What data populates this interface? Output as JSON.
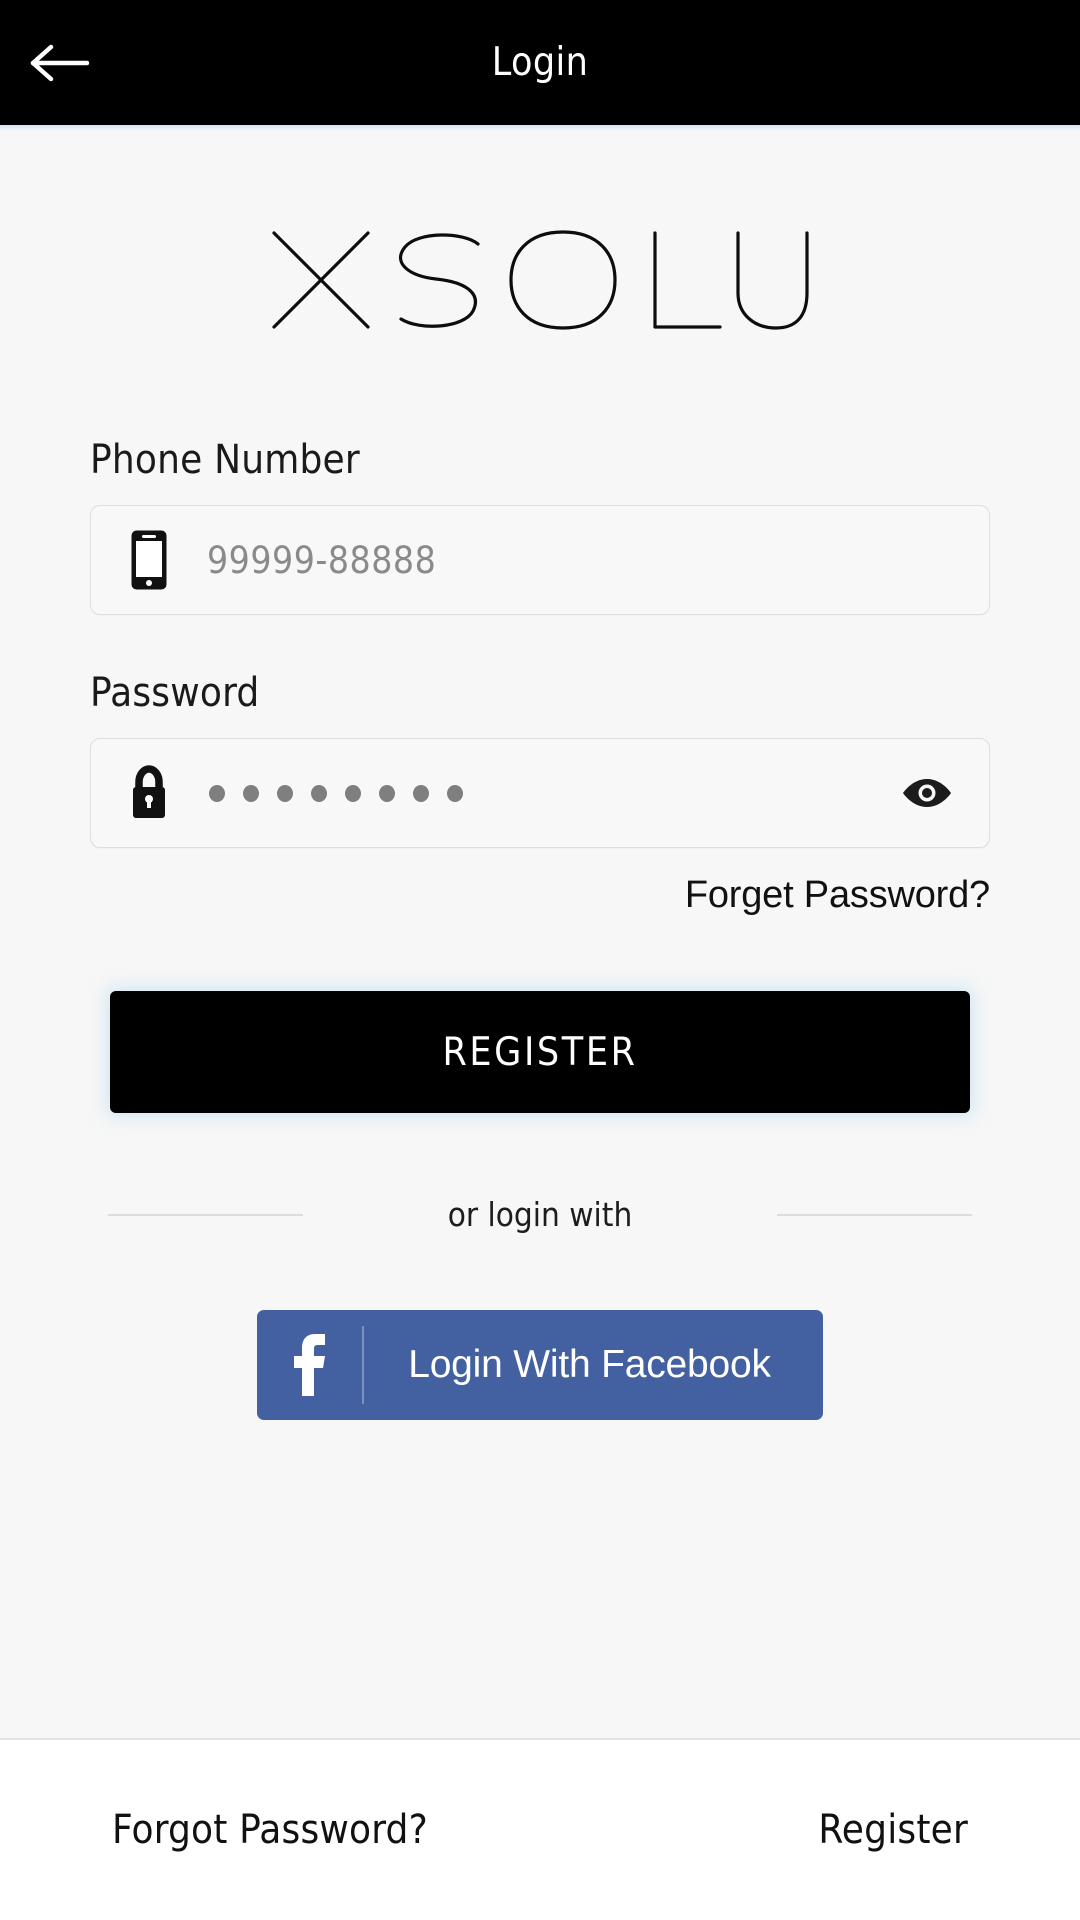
{
  "header": {
    "title": "Login",
    "back_icon": "arrow-left-icon",
    "background_color": "#000000",
    "text_color": "#ffffff"
  },
  "brand": {
    "logo_text": "XSOLU"
  },
  "form": {
    "phone": {
      "label": "Phone Number",
      "icon": "mobile-phone-icon",
      "placeholder": "99999-88888",
      "value": ""
    },
    "password": {
      "label": "Password",
      "icon": "lock-icon",
      "masked_value": "••••••••",
      "mask_dot_count": 8,
      "toggle_icon": "eye-icon",
      "value": ""
    },
    "forget_password_link": "Forget Password?"
  },
  "primary_action": {
    "label": "REGISTER",
    "background_color": "#000000",
    "text_color": "#ffffff"
  },
  "social": {
    "divider_text": "or login with",
    "facebook": {
      "label": "Login With Facebook",
      "icon": "facebook-f-icon",
      "background_color": "#4360a0",
      "text_color": "#ffffff"
    }
  },
  "bottom_bar": {
    "forgot_password": "Forgot Password?",
    "register": "Register"
  }
}
